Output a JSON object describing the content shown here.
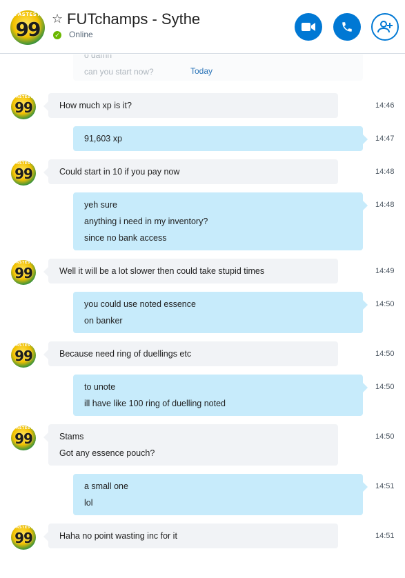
{
  "header": {
    "title": "FUTchamps - Sythe",
    "status": "Online",
    "avatar_text": "FASTEST",
    "avatar_number": "99",
    "buttons": [
      "video-call",
      "voice-call",
      "add-people"
    ],
    "accent": "#0078d4",
    "online_color": "#6bb700"
  },
  "timeline": {
    "faded_lines": [
      "o damn",
      "can you start now?"
    ],
    "date_divider": "Today",
    "messages": [
      {
        "side": "in",
        "lines": [
          "How much xp is it?"
        ],
        "time": "14:46"
      },
      {
        "side": "out",
        "lines": [
          "91,603 xp"
        ],
        "time": "14:47"
      },
      {
        "side": "in",
        "lines": [
          "Could start in 10 if you pay now"
        ],
        "time": "14:48"
      },
      {
        "side": "out",
        "lines": [
          "yeh sure",
          "anything i need in my inventory?",
          "since no bank access"
        ],
        "time": "14:48"
      },
      {
        "side": "in",
        "lines": [
          "Well it will be a lot slower then could take stupid times"
        ],
        "time": "14:49"
      },
      {
        "side": "out",
        "lines": [
          "you could use noted essence",
          "on banker"
        ],
        "time": "14:50"
      },
      {
        "side": "in",
        "lines": [
          "Because need ring of duellings etc"
        ],
        "time": "14:50"
      },
      {
        "side": "out",
        "lines": [
          "to unote",
          "ill have like 100 ring of duelling noted"
        ],
        "time": "14:50"
      },
      {
        "side": "in",
        "lines": [
          "Stams",
          "Got any essence pouch?"
        ],
        "time": "14:50"
      },
      {
        "side": "out",
        "lines": [
          "a small one",
          "lol"
        ],
        "time": "14:51"
      },
      {
        "side": "in",
        "lines": [
          "Haha no point wasting inc for it"
        ],
        "time": "14:51"
      }
    ]
  }
}
